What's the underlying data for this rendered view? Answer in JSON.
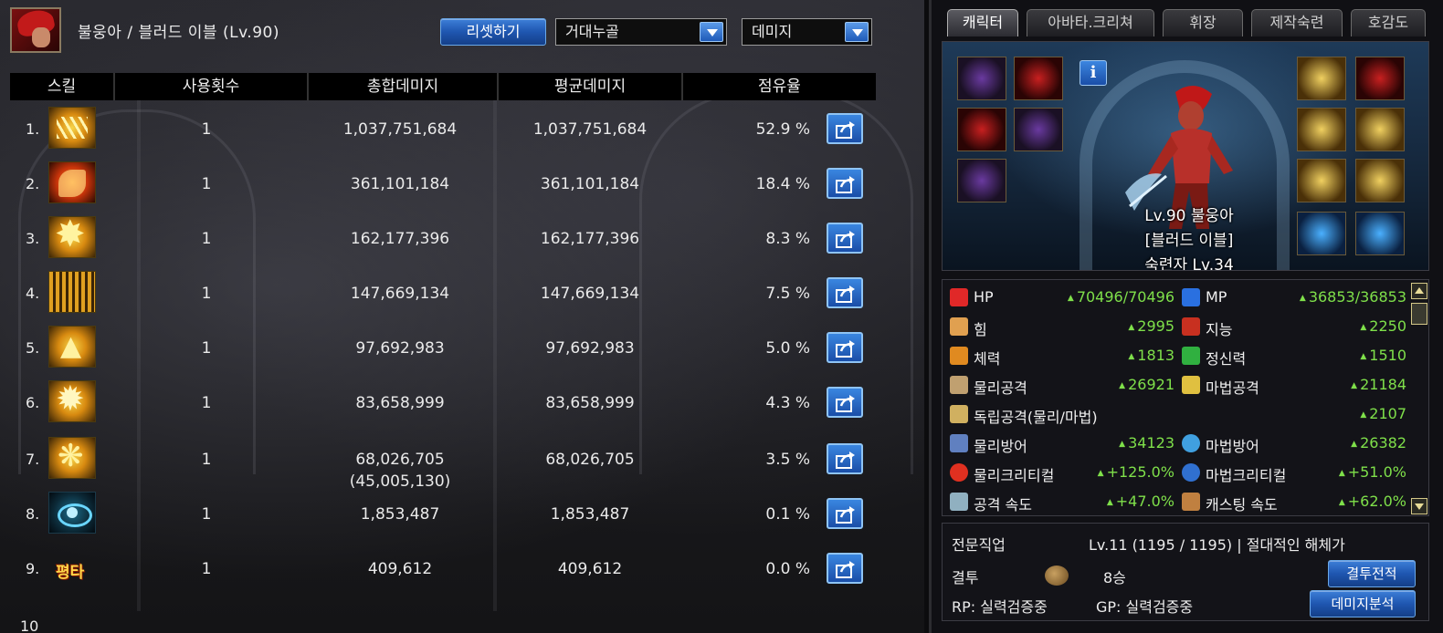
{
  "header": {
    "title": "불웅아 / 블러드 이블 (Lv.90)",
    "reset_label": "리셋하기",
    "boss_select": "거대누골",
    "metric_select": "데미지"
  },
  "table": {
    "columns": [
      "스킬",
      "사용횟수",
      "총합데미지",
      "평균데미지",
      "점유율"
    ],
    "rows": [
      {
        "num": "1.",
        "count": "1",
        "total": "1,037,751,684",
        "avg": "1,037,751,684",
        "share": "52.9 %"
      },
      {
        "num": "2.",
        "count": "1",
        "total": "361,101,184",
        "avg": "361,101,184",
        "share": "18.4 %"
      },
      {
        "num": "3.",
        "count": "1",
        "total": "162,177,396",
        "avg": "162,177,396",
        "share": "8.3 %"
      },
      {
        "num": "4.",
        "count": "1",
        "total": "147,669,134",
        "avg": "147,669,134",
        "share": "7.5 %"
      },
      {
        "num": "5.",
        "count": "1",
        "total": "97,692,983",
        "avg": "97,692,983",
        "share": "5.0 %"
      },
      {
        "num": "6.",
        "count": "1",
        "total": "83,658,999",
        "avg": "83,658,999",
        "share": "4.3 %"
      },
      {
        "num": "7.",
        "count": "1",
        "total": "68,026,705",
        "sub": "(45,005,130)",
        "avg": "68,026,705",
        "share": "3.5 %"
      },
      {
        "num": "8.",
        "count": "1",
        "total": "1,853,487",
        "avg": "1,853,487",
        "share": "0.1 %"
      },
      {
        "num": "9.",
        "count": "1",
        "total": "409,612",
        "avg": "409,612",
        "share": "0.0 %",
        "icon_text": "평타"
      }
    ],
    "next_row_num": "10"
  },
  "tabs": [
    "캐릭터",
    "아바타.크리쳐",
    "휘장",
    "제작숙련",
    "호감도"
  ],
  "character": {
    "line1": "Lv.90 불웅아",
    "line2": "[블러드 이블]",
    "line3": "숙련자 Lv.34",
    "info_label": "i"
  },
  "stats": [
    {
      "label": "HP",
      "value": "70496/70496",
      "icon": "heart-icon",
      "color": "#e02828"
    },
    {
      "label": "MP",
      "value": "36853/36853",
      "icon": "blue-heart-icon",
      "color": "#2a70e0"
    },
    {
      "label": "힘",
      "value": "2995",
      "icon": "arm-icon",
      "color": "#e0a050"
    },
    {
      "label": "지능",
      "value": "2250",
      "icon": "eye-icon",
      "color": "#c83020"
    },
    {
      "label": "체력",
      "value": "1813",
      "icon": "body-icon",
      "color": "#e08a20"
    },
    {
      "label": "정신력",
      "value": "1510",
      "icon": "spirit-icon",
      "color": "#30b040"
    },
    {
      "label": "물리공격",
      "value": "26921",
      "icon": "sword-icon",
      "color": "#c0a070"
    },
    {
      "label": "마법공격",
      "value": "21184",
      "icon": "sparkle-icon",
      "color": "#e0c040"
    },
    {
      "label": "독립공격(물리/마법)",
      "value": "2107",
      "icon": "independent-attack-icon",
      "color": "#d0b060"
    },
    {
      "label": "물리방어",
      "value": "34123",
      "icon": "shield-icon",
      "color": "#6080c0"
    },
    {
      "label": "마법방어",
      "value": "26382",
      "icon": "orb-icon",
      "color": "#40a0e0"
    },
    {
      "label": "물리크리티컬",
      "value": "+125.0%",
      "icon": "crosshair-icon",
      "color": "#e03020"
    },
    {
      "label": "마법크리티컬",
      "value": "+51.0%",
      "icon": "magic-crit-icon",
      "color": "#3070d0"
    },
    {
      "label": "공격 속도",
      "value": "+47.0%",
      "icon": "attack-speed-icon",
      "color": "#90b0c0"
    },
    {
      "label": "캐스팅 속도",
      "value": "+62.0%",
      "icon": "cast-speed-icon",
      "color": "#c08040"
    }
  ],
  "bottom": {
    "job_label": "전문직업",
    "job_value": "Lv.11 (1195 / 1195) | 절대적인 해체가",
    "pvp_label": "결투",
    "pvp_value": "8승",
    "pvp_record_button": "결투전적",
    "rp_text": "RP: 실력검증중",
    "gp_text": "GP: 실력검증중",
    "damage_analysis_button": "데미지분석"
  }
}
